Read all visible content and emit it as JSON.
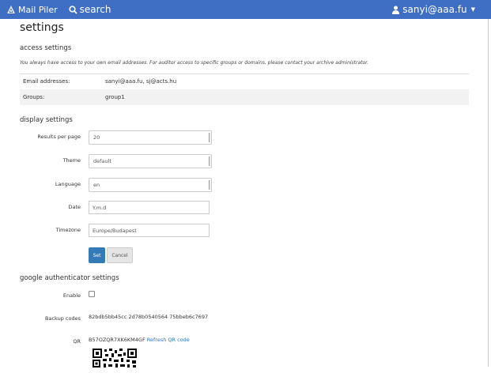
{
  "navbar": {
    "brand": "Mail Piler",
    "search": "search",
    "user": "sanyi@aaa.fu",
    "colors": {
      "bar": "#3f6fc4",
      "text": "#ffffff"
    },
    "icons": {
      "brand": "piler-logo-icon",
      "search": "search-icon",
      "user": "user-icon",
      "caret": "caret-down-icon"
    }
  },
  "page": {
    "title": "settings"
  },
  "access": {
    "title": "access settings",
    "note": "You always have access to your own email addresses. For auditor access to specific groups or domains, please contact your archive administrator.",
    "rows": [
      {
        "label": "Email addresses:",
        "value": "sanyi@aaa.fu, sj@acts.hu"
      },
      {
        "label": "Groups:",
        "value": "group1"
      }
    ]
  },
  "display": {
    "title": "display settings",
    "results_label": "Results per page",
    "results_value": "20",
    "theme_label": "Theme",
    "theme_value": "default",
    "language_label": "Language",
    "language_value": "en",
    "date_label": "Date",
    "date_value": "Y.m.d",
    "timezone_label": "Timezone",
    "timezone_value": "Europe/Budapest",
    "set_label": "Set",
    "cancel_label": "Cancel"
  },
  "google": {
    "title": "google authenticator settings",
    "enable_label": "Enable",
    "enabled": false,
    "backup_label": "Backup codes",
    "backup_value": "82bdb5bb45cc 2d78b0540564 75bbeb6c7697",
    "qr_label": "QR",
    "qr_secret": "B57OZQR7XK6KM4GF",
    "refresh_label": "Refresh QR code"
  }
}
